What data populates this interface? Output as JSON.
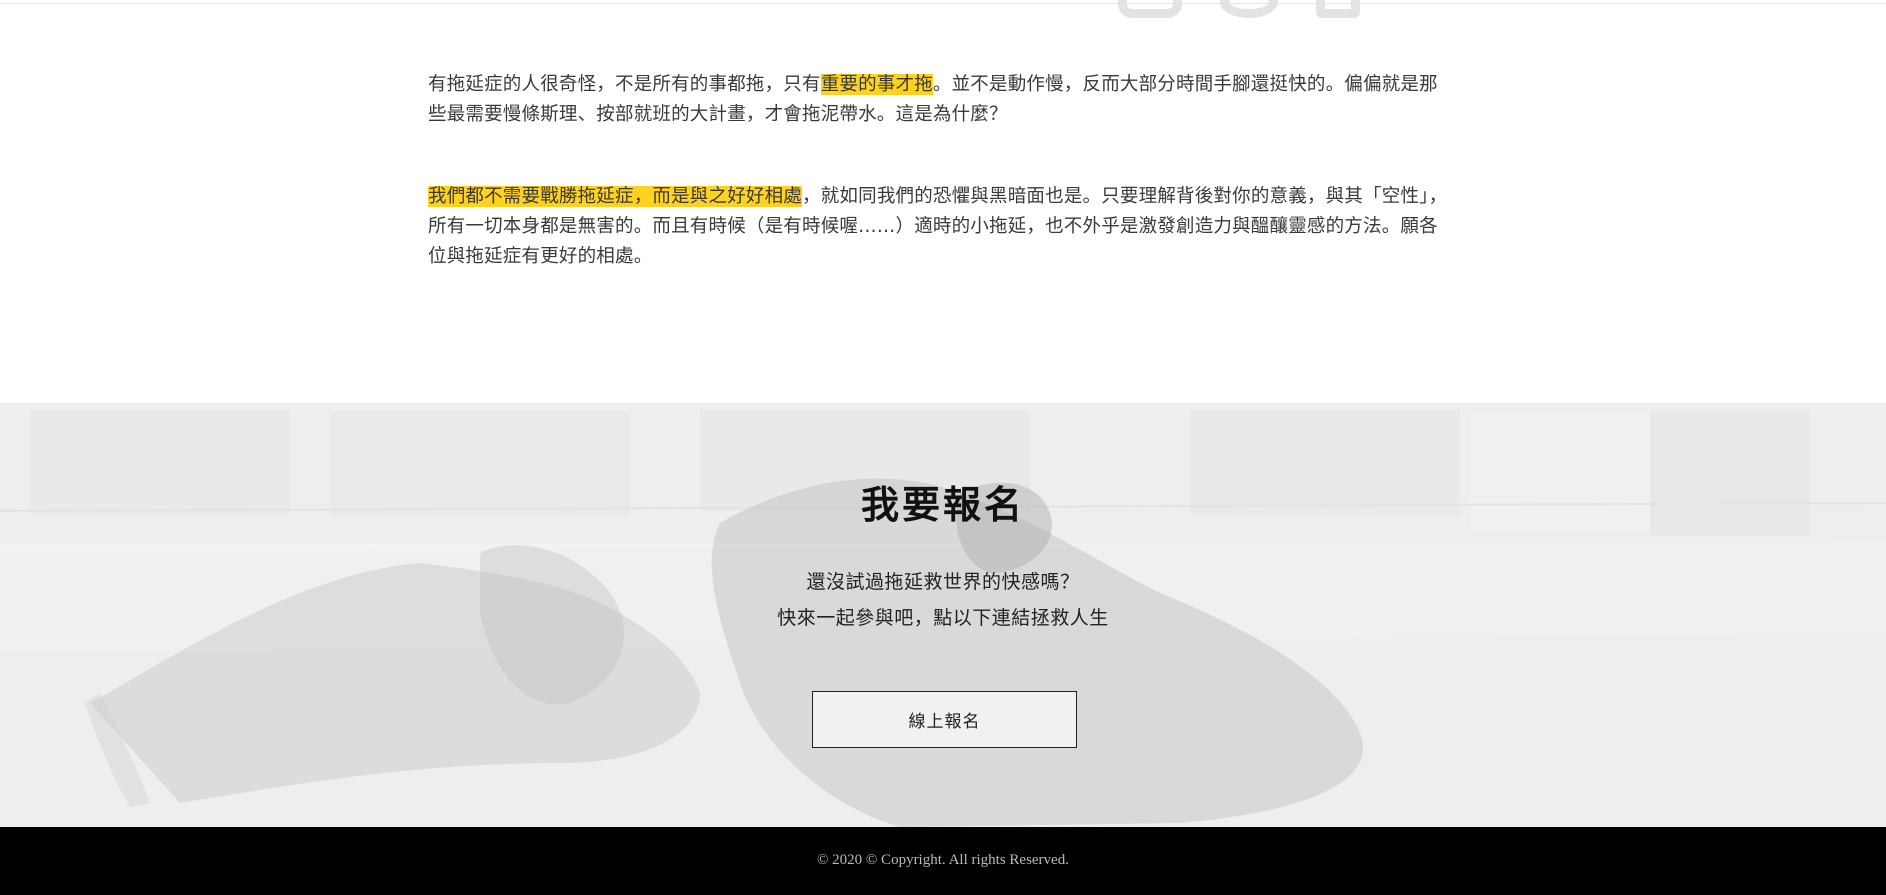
{
  "article": {
    "paragraph1": {
      "before": "有拖延症的人很奇怪，不是所有的事都拖，只有",
      "highlight": "重要的事才拖",
      "after": "。並不是動作慢，反而大部分時間手腳還挺快的。偏偏就是那些最需要慢條斯理、按部就班的大計畫，才會拖泥帶水。這是為什麼？"
    },
    "paragraph2": {
      "highlight": "我們都不需要戰勝拖延症，而是與之好好相處",
      "after": "，就如同我們的恐懼與黑暗面也是。只要理解背後對你的意義，與其「空性」，所有一切本身都是無害的。而且有時候（是有時候喔……）適時的小拖延，也不外乎是激發創造力與醞釀靈感的方法。願各位與拖延症有更好的相處。"
    },
    "highlight_color": "#ffd21f"
  },
  "register": {
    "title": "我要報名",
    "line1": "還沒試過拖延救世界的快感嗎？",
    "line2": "快來一起參與吧，點以下連結拯救人生",
    "button_label": "線上報名"
  },
  "footer": {
    "copyright": "© 2020 © Copyright. All rights Reserved."
  },
  "colors": {
    "footer_background": "#000000",
    "page_background": "#ffffff"
  }
}
